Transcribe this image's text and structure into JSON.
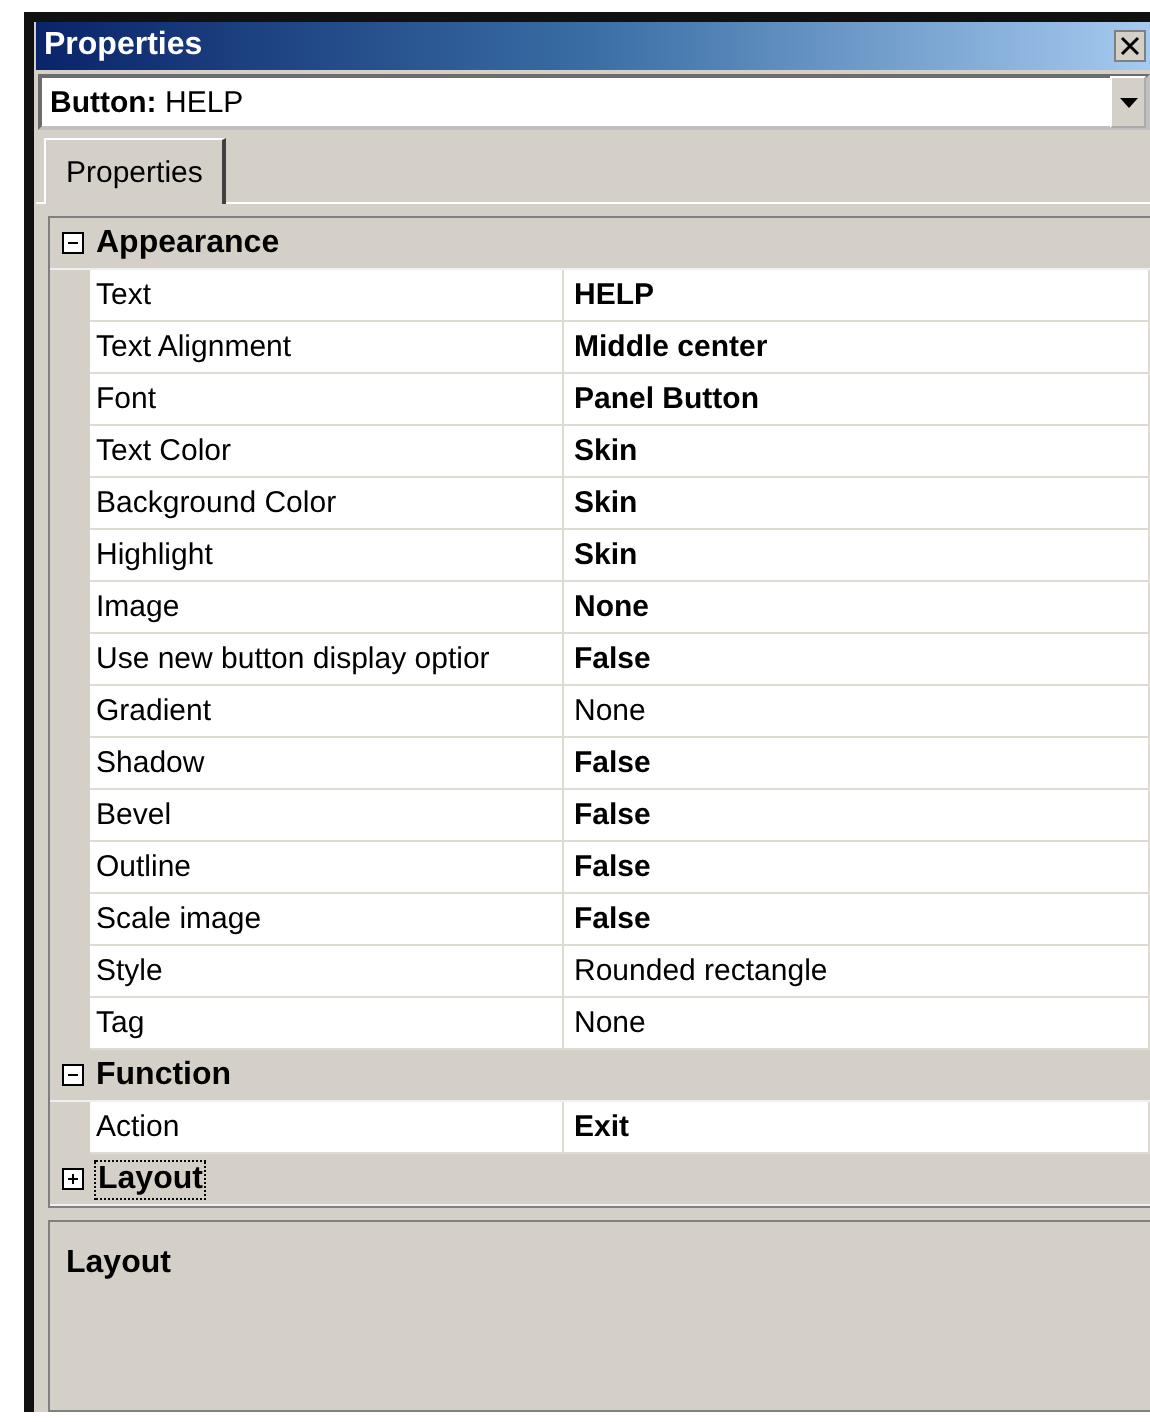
{
  "window": {
    "title": "Properties"
  },
  "object_selector": {
    "label": "Button:",
    "value": "HELP"
  },
  "tabs": [
    {
      "label": "Properties",
      "selected": true
    }
  ],
  "categories": [
    {
      "name": "Appearance",
      "expanded": true,
      "properties": [
        {
          "name": "Text",
          "value": "HELP",
          "modified": true
        },
        {
          "name": "Text Alignment",
          "value": "Middle center",
          "modified": true
        },
        {
          "name": "Font",
          "value": "Panel Button",
          "modified": true
        },
        {
          "name": "Text Color",
          "value": "Skin",
          "modified": true
        },
        {
          "name": "Background Color",
          "value": "Skin",
          "modified": true
        },
        {
          "name": "Highlight",
          "value": "Skin",
          "modified": true
        },
        {
          "name": "Image",
          "value": "None",
          "modified": true
        },
        {
          "name": "Use new button display optior",
          "value": "False",
          "modified": true
        },
        {
          "name": "Gradient",
          "value": "None",
          "modified": false
        },
        {
          "name": "Shadow",
          "value": "False",
          "modified": true
        },
        {
          "name": "Bevel",
          "value": "False",
          "modified": true
        },
        {
          "name": "Outline",
          "value": "False",
          "modified": true
        },
        {
          "name": "Scale image",
          "value": "False",
          "modified": true
        },
        {
          "name": "Style",
          "value": "Rounded rectangle",
          "modified": false
        },
        {
          "name": "Tag",
          "value": "None",
          "modified": false
        }
      ]
    },
    {
      "name": "Function",
      "expanded": true,
      "properties": [
        {
          "name": "Action",
          "value": "Exit",
          "modified": true
        }
      ]
    },
    {
      "name": "Layout",
      "expanded": false,
      "selected": true
    }
  ],
  "description": {
    "title": "Layout"
  }
}
